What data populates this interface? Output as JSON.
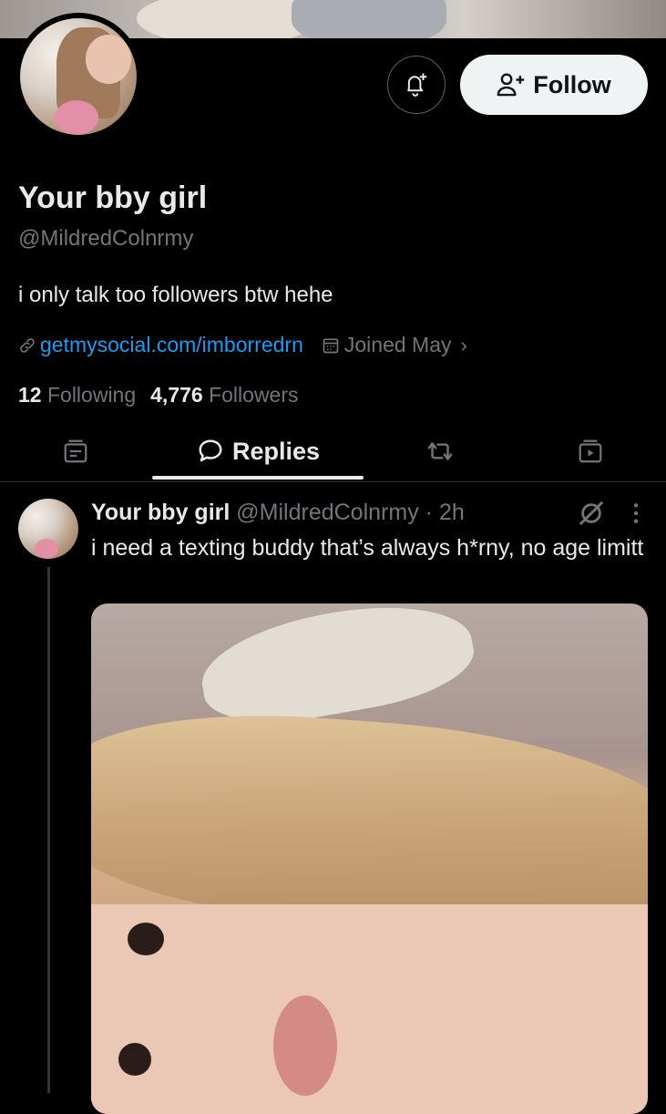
{
  "profile": {
    "name": "Your bby girl",
    "handle": "@MildredColnrmy",
    "bio": "i only talk too followers btw hehe",
    "link": "getmysocial.com/imborredrn",
    "joined": "Joined May",
    "following_count": "12",
    "following_label": "Following",
    "followers_count": "4,776",
    "followers_label": "Followers"
  },
  "actions": {
    "follow_label": "Follow"
  },
  "tabs": [
    {
      "icon": "card-icon",
      "label": ""
    },
    {
      "icon": "speech-bubble-icon",
      "label": "Replies"
    },
    {
      "icon": "repost-icon",
      "label": ""
    },
    {
      "icon": "video-card-icon",
      "label": ""
    }
  ],
  "post": {
    "name": "Your bby girl",
    "handle": "@MildredColnrmy",
    "separator": "·",
    "time": "2h",
    "text": "i need a texting buddy that’s always h*rny, no age limitt"
  },
  "colors": {
    "background": "#000000",
    "text": "#e7e9ea",
    "muted": "#71767b",
    "link": "#1d9bf0",
    "follow_bg": "#eff3f4"
  }
}
